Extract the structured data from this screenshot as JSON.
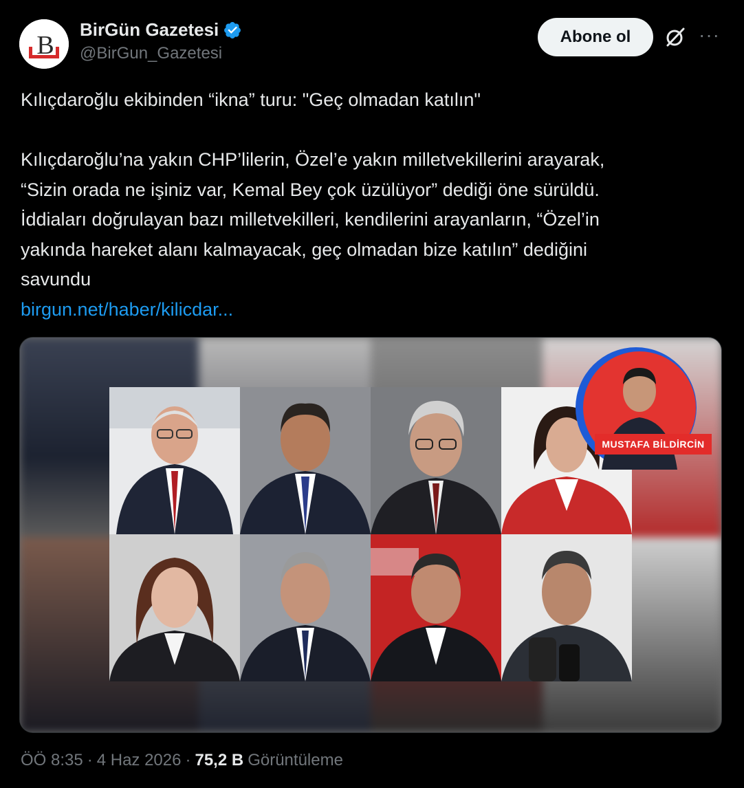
{
  "account": {
    "name": "BirGün Gazetesi",
    "handle": "@BirGun_Gazetesi",
    "verified_color": "#1d9bf0"
  },
  "actions": {
    "follow_label": "Abone ol",
    "more_label": "···"
  },
  "tweet": {
    "headline": "Kılıçdaroğlu ekibinden “ikna” turu: \"Geç olmadan katılın\"",
    "body_lines": [
      "Kılıçdaroğlu’na yakın CHP’lilerin, Özel’e yakın milletvekillerini arayarak,",
      "“Sizin orada ne işiniz var, Kemal Bey çok üzülüyor” dediği öne sürüldü.",
      "İddiaları doğrulayan bazı milletvekilleri, kendilerini arayanların, “Özel’in",
      "yakında hareket alanı kalmayacak, geç olmadan bize katılın” dediğini",
      "savundu"
    ],
    "link_text": "birgun.net/haber/kilicdar..."
  },
  "media": {
    "author_badge": "MUSTAFA BİLDİRCİN",
    "portraits": 8
  },
  "meta": {
    "time": "ÖÖ 8:35",
    "sep1": "·",
    "date": "4 Haz 2026",
    "sep2": "·",
    "views": "75,2 B",
    "views_label": "Görüntüleme"
  }
}
